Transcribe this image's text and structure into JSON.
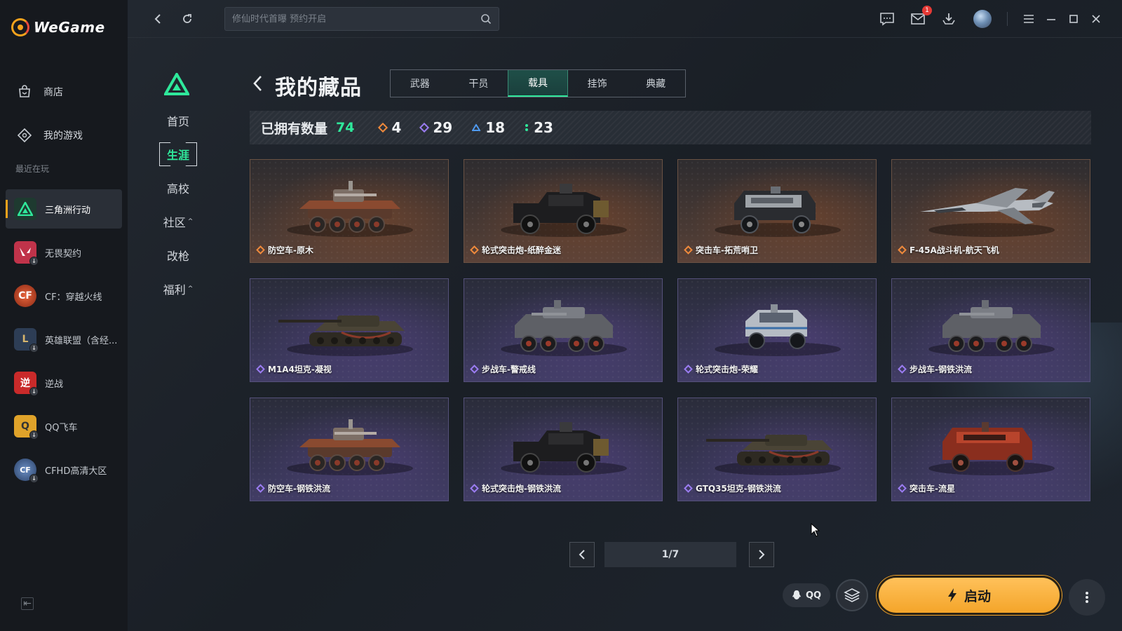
{
  "app": {
    "name": "WeGame"
  },
  "sidebar": {
    "nav": [
      {
        "label": "商店",
        "icon": "store-icon"
      },
      {
        "label": "我的游戏",
        "icon": "my-games-icon"
      }
    ],
    "recent_label": "最近在玩",
    "games": [
      {
        "label": "三角洲行动",
        "icon": "delta-force-icon",
        "color": "#1e3a30",
        "active": true
      },
      {
        "label": "无畏契约",
        "icon": "valorant-icon",
        "color": "#c0334a"
      },
      {
        "label": "CF：穿越火线",
        "icon": "crossfire-icon",
        "color": "#b8462a"
      },
      {
        "label": "英雄联盟（含经...",
        "icon": "lol-icon",
        "color": "#2d3d55"
      },
      {
        "label": "逆战",
        "icon": "nizhan-icon",
        "color": "#c92a2a"
      },
      {
        "label": "QQ飞车",
        "icon": "qq-speed-icon",
        "color": "#e0a32a"
      },
      {
        "label": "CFHD高清大区",
        "icon": "cfhd-icon",
        "color": "#3a5b8a"
      }
    ]
  },
  "topbar": {
    "search_placeholder": "修仙时代首曝 预约开启",
    "mail_badge": "1"
  },
  "game_nav": {
    "items": [
      {
        "label": "首页"
      },
      {
        "label": "生涯",
        "active": true
      },
      {
        "label": "高校"
      },
      {
        "label": "社区",
        "caret": "^"
      },
      {
        "label": "改枪"
      },
      {
        "label": "福利",
        "caret": "^"
      }
    ]
  },
  "collection": {
    "title": "我的藏品",
    "tabs": [
      {
        "label": "武器"
      },
      {
        "label": "干员"
      },
      {
        "label": "载具",
        "active": true
      },
      {
        "label": "挂饰"
      },
      {
        "label": "典藏"
      }
    ],
    "owned_label": "已拥有数量",
    "owned_total": "74",
    "rarity_counts": [
      {
        "value": "4",
        "color": "#f08a3c"
      },
      {
        "value": "29",
        "color": "#9b7cf2"
      },
      {
        "value": "18",
        "color": "#4f9af0"
      },
      {
        "value": "23",
        "color": "#2fe89b"
      }
    ],
    "items": [
      {
        "name": "防空车-原木",
        "rarity": "gold",
        "art": "aa-vehicle"
      },
      {
        "name": "轮式突击炮-纸醉金迷",
        "rarity": "gold",
        "art": "armored-truck"
      },
      {
        "name": "突击车-拓荒哨卫",
        "rarity": "gold",
        "art": "assault-car"
      },
      {
        "name": "F-45A战斗机-航天飞机",
        "rarity": "gold",
        "art": "jet"
      },
      {
        "name": "M1A4坦克-凝视",
        "rarity": "purple",
        "art": "tank"
      },
      {
        "name": "步战车-警戒线",
        "rarity": "purple",
        "art": "ifv"
      },
      {
        "name": "轮式突击炮-荣耀",
        "rarity": "purple",
        "art": "buggy"
      },
      {
        "name": "步战车-钢铁洪流",
        "rarity": "purple",
        "art": "ifv"
      },
      {
        "name": "防空车-钢铁洪流",
        "rarity": "purple",
        "art": "aa-vehicle"
      },
      {
        "name": "轮式突击炮-钢铁洪流",
        "rarity": "purple",
        "art": "armored-truck"
      },
      {
        "name": "GTQ35坦克-钢铁洪流",
        "rarity": "purple",
        "art": "tank"
      },
      {
        "name": "突击车-流星",
        "rarity": "purple",
        "art": "assault-car-red"
      }
    ],
    "pager": {
      "text": "1/7"
    }
  },
  "footer": {
    "qq_label": "QQ",
    "launch_label": "启动"
  }
}
